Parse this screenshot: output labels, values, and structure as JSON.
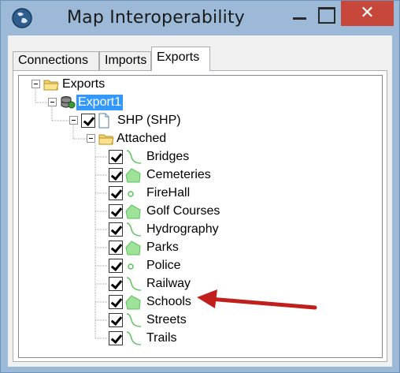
{
  "window": {
    "title": "Map Interoperability",
    "close_symbol": "✕",
    "colors": {
      "title_bar": "#9cbad8",
      "close_button": "#c7483a",
      "selection": "#3399ff",
      "polygon_icon": "#9fe29a",
      "arrow": "#c0201c"
    }
  },
  "tabs": [
    {
      "label": "Connections",
      "active": false
    },
    {
      "label": "Imports",
      "active": false
    },
    {
      "label": "Exports",
      "active": true
    }
  ],
  "tree": {
    "root": {
      "label": "Exports",
      "icon": "folder-icon"
    },
    "export1": {
      "label": "Export1",
      "icon": "database-icon",
      "selected": true
    },
    "shp": {
      "label": "SHP (SHP)",
      "icon": "document-icon",
      "checked": true
    },
    "attached": {
      "label": "Attached",
      "icon": "folder-icon"
    },
    "layers": [
      {
        "label": "Bridges",
        "icon": "line-icon",
        "checked": true
      },
      {
        "label": "Cemeteries",
        "icon": "polygon-icon",
        "checked": true
      },
      {
        "label": "FireHall",
        "icon": "point-icon",
        "checked": true
      },
      {
        "label": "Golf Courses",
        "icon": "polygon-icon",
        "checked": true
      },
      {
        "label": "Hydrography",
        "icon": "line-icon",
        "checked": true
      },
      {
        "label": "Parks",
        "icon": "polygon-icon",
        "checked": true
      },
      {
        "label": "Police",
        "icon": "point-icon",
        "checked": true
      },
      {
        "label": "Railway",
        "icon": "line-icon",
        "checked": true
      },
      {
        "label": "Schools",
        "icon": "polygon-icon",
        "checked": true,
        "highlighted_by_arrow": true
      },
      {
        "label": "Streets",
        "icon": "line-icon",
        "checked": true
      },
      {
        "label": "Trails",
        "icon": "line-icon",
        "checked": true
      }
    ]
  }
}
